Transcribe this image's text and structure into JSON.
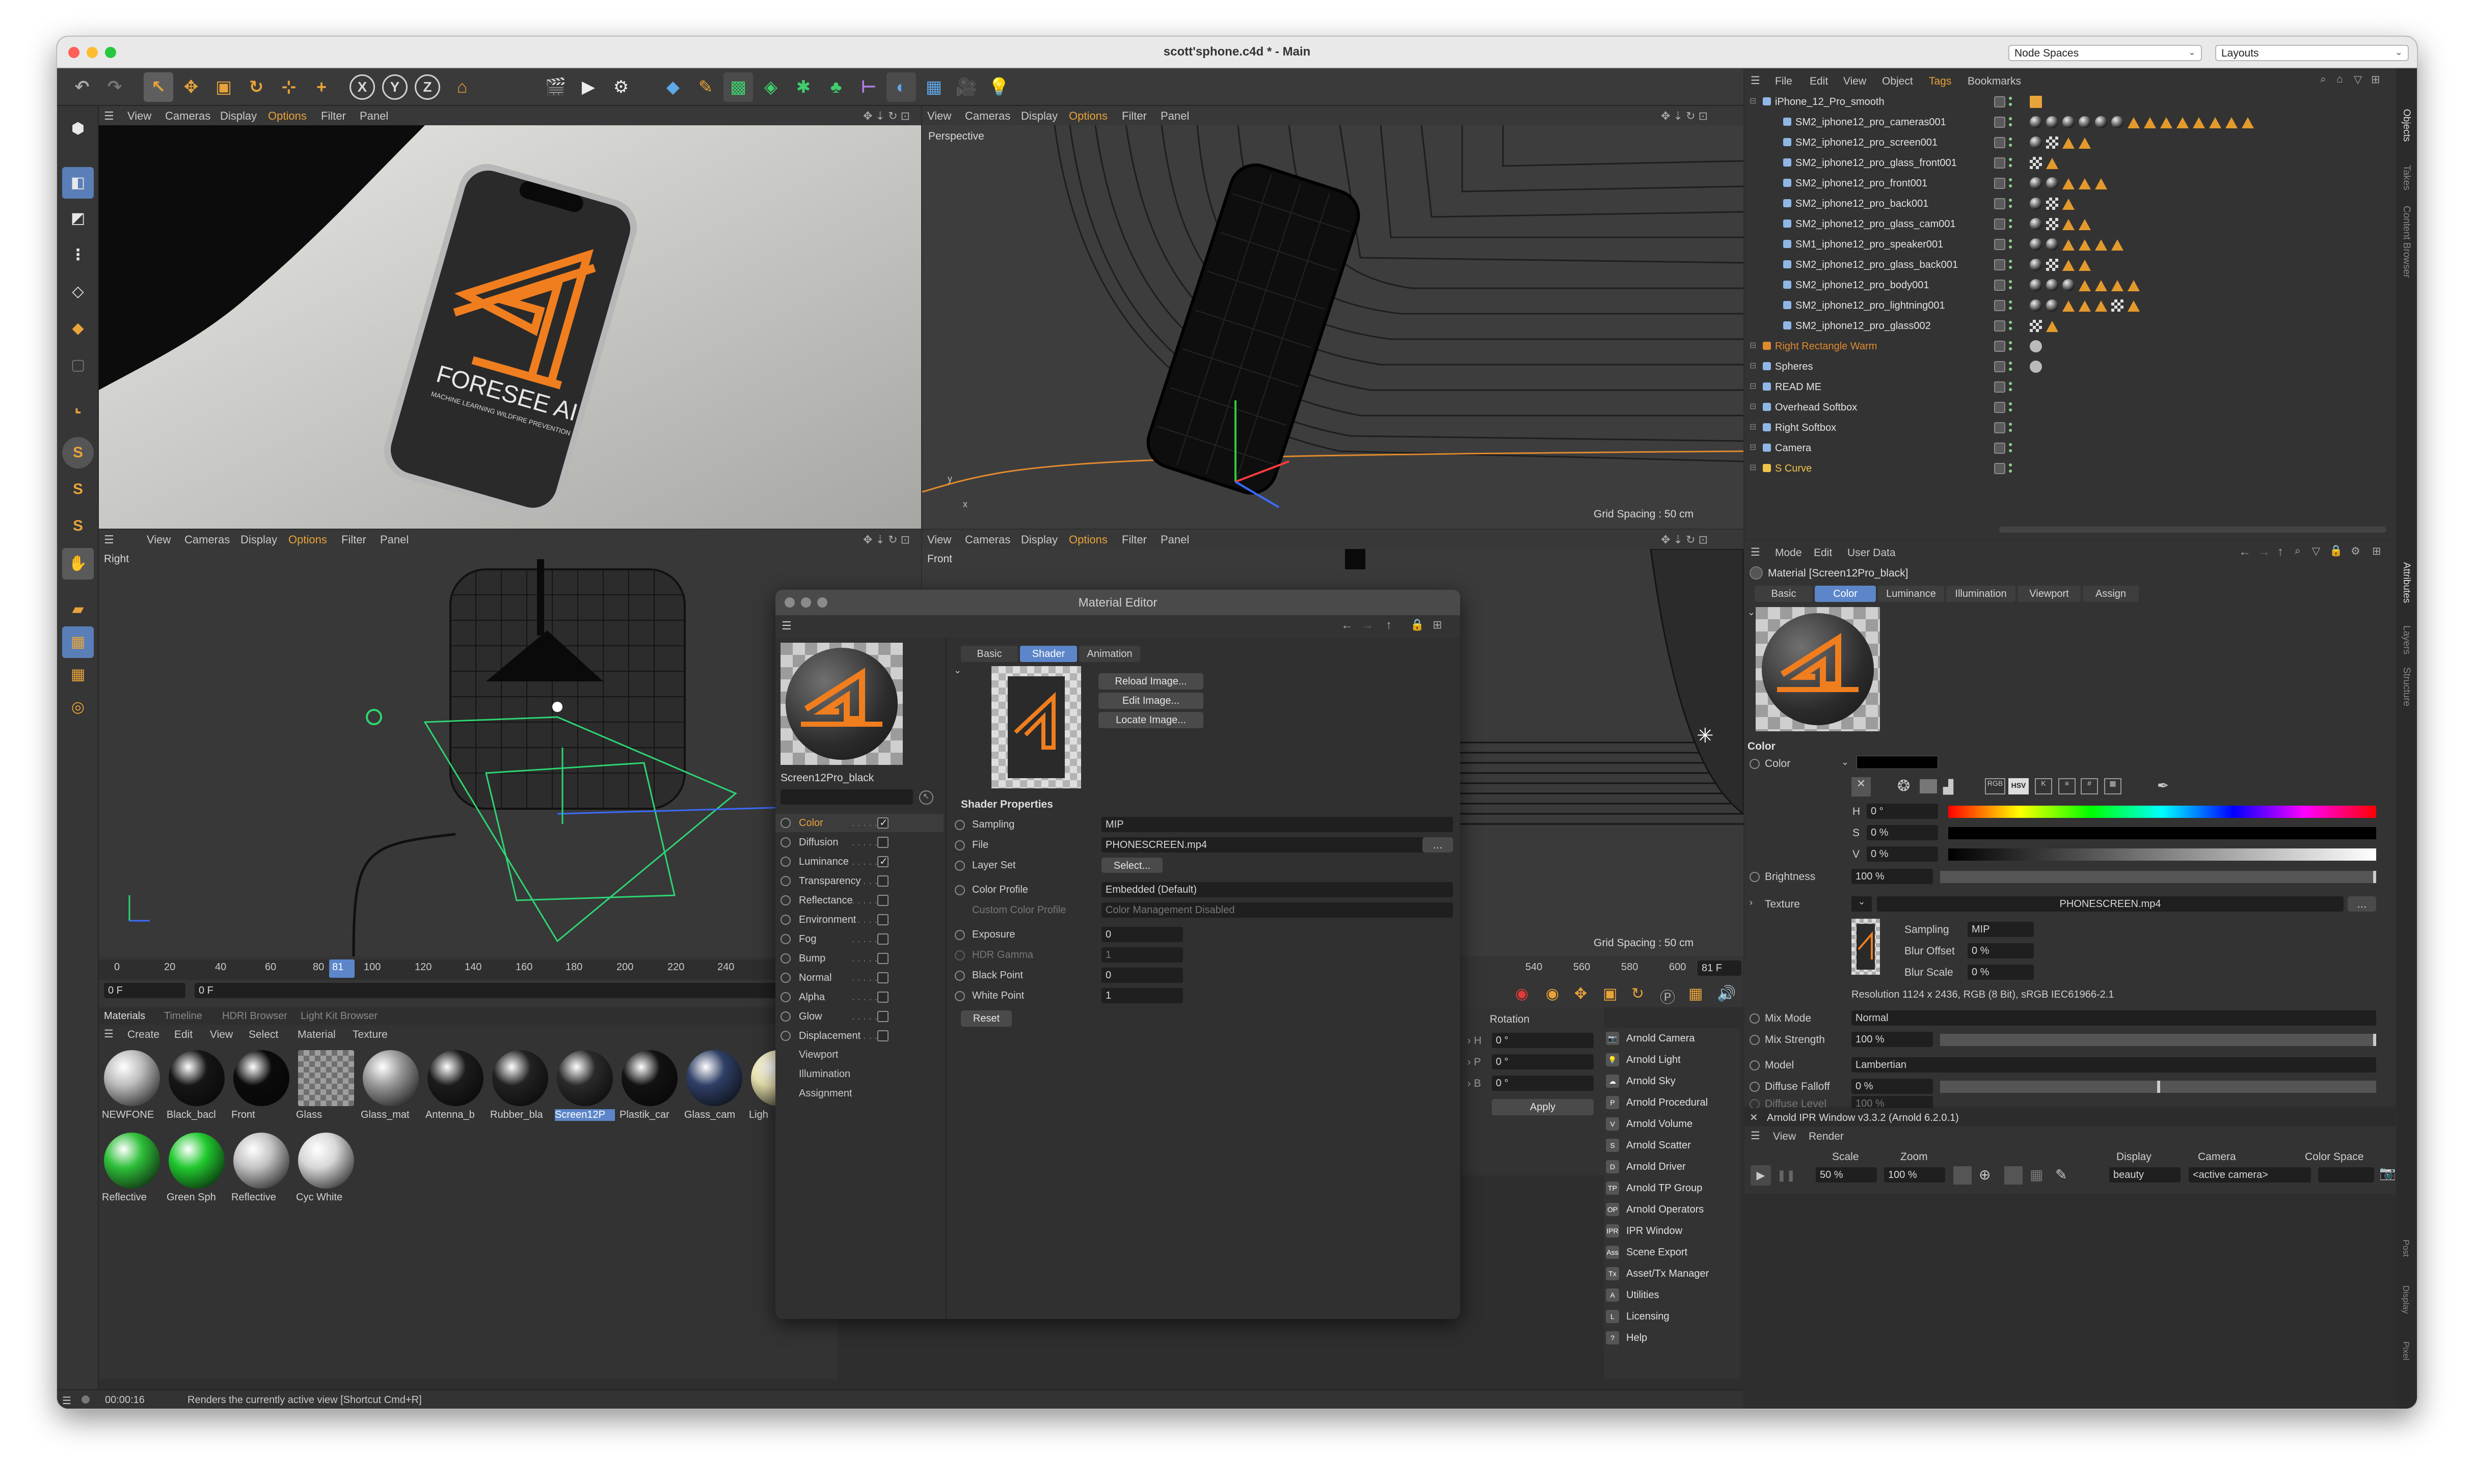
{
  "window": {
    "title": "scott'sphone.c4d * - Main",
    "node_spaces": "Node Spaces",
    "layouts": "Layouts"
  },
  "viewport_menu": [
    "View",
    "Cameras",
    "Display",
    "Options",
    "Filter",
    "Panel"
  ],
  "viewports": {
    "top_right_label": "Perspective",
    "bottom_left_label": "Right",
    "bottom_right_label": "Front",
    "grid_top": "Grid Spacing : 50 cm",
    "grid_bottom": "Grid Spacing : 50 cm"
  },
  "render_text": {
    "logo": "FORESEE AI",
    "tagline": "MACHINE LEARNING WILDFIRE PREVENTION"
  },
  "timeline": {
    "ticks": [
      "0",
      "20",
      "40",
      "60",
      "80",
      "81",
      "100",
      "120",
      "140",
      "160",
      "180",
      "200",
      "220",
      "240"
    ],
    "ticks_right": [
      "540",
      "560",
      "580",
      "600"
    ],
    "frame_field": "81 F",
    "start": "0 F",
    "current": "0 F"
  },
  "material_tabs": [
    "Materials",
    "Timeline",
    "HDRI Browser",
    "Light Kit Browser"
  ],
  "material_menu": [
    "Create",
    "Edit",
    "View",
    "Select",
    "Material",
    "Texture"
  ],
  "materials": [
    {
      "name": "NEWFONE",
      "color": "#bdbdbd"
    },
    {
      "name": "Black_bacl",
      "color": "#161616"
    },
    {
      "name": "Front",
      "color": "#0b0b0b"
    },
    {
      "name": "Glass",
      "color": "checker"
    },
    {
      "name": "Glass_mat",
      "color": "#9a9a9a"
    },
    {
      "name": "Antenna_b",
      "color": "#1c1c1c"
    },
    {
      "name": "Rubber_bla",
      "color": "#222222"
    },
    {
      "name": "Screen12P",
      "color": "#2a2a2a"
    },
    {
      "name": "Plastik_car",
      "color": "#121212"
    },
    {
      "name": "Glass_cam",
      "color": "#2f3f66"
    },
    {
      "name": "Ligh",
      "color": "#e9e3b0"
    },
    {
      "name": "Reflective",
      "color": "#2fbf3a"
    },
    {
      "name": "Green Sph",
      "color": "#21c92f"
    },
    {
      "name": "Reflective",
      "color": "#c4c4c4"
    },
    {
      "name": "Cyc White",
      "color": "#d7d7d7"
    }
  ],
  "status": {
    "time": "00:00:16",
    "message": "Renders the currently active view [Shortcut Cmd+R]"
  },
  "material_editor": {
    "title": "Material Editor",
    "mat_name": "Screen12Pro_black",
    "channels": [
      {
        "label": "Color",
        "checked": true
      },
      {
        "label": "Diffusion",
        "checked": false
      },
      {
        "label": "Luminance",
        "checked": true
      },
      {
        "label": "Transparency",
        "checked": false
      },
      {
        "label": "Reflectance",
        "checked": false
      },
      {
        "label": "Environment",
        "checked": false
      },
      {
        "label": "Fog",
        "checked": false
      },
      {
        "label": "Bump",
        "checked": false
      },
      {
        "label": "Normal",
        "checked": false
      },
      {
        "label": "Alpha",
        "checked": false
      },
      {
        "label": "Glow",
        "checked": false
      },
      {
        "label": "Displacement",
        "checked": false
      }
    ],
    "extra": [
      "Viewport",
      "Illumination",
      "Assignment"
    ],
    "tabs": [
      "Basic",
      "Shader",
      "Animation"
    ],
    "buttons": [
      "Reload Image...",
      "Edit Image...",
      "Locate Image..."
    ],
    "section": "Shader Properties",
    "props": [
      {
        "label": "Sampling",
        "value": "MIP"
      },
      {
        "label": "File",
        "value": "PHONESCREEN.mp4"
      },
      {
        "label": "Layer Set",
        "value": "Select..."
      },
      {
        "label": "Color Profile",
        "value": "Embedded (Default)"
      },
      {
        "label": "Custom Color Profile",
        "value": "Color Management Disabled"
      },
      {
        "label": "Exposure",
        "value": "0"
      },
      {
        "label": "HDR Gamma",
        "value": "1"
      },
      {
        "label": "Black Point",
        "value": "0"
      },
      {
        "label": "White Point",
        "value": "1"
      }
    ],
    "reset": "Reset"
  },
  "coords": {
    "title": "Rotation",
    "h": "0 °",
    "p": "0 °",
    "b": "0 °",
    "apply": "Apply"
  },
  "arnold": [
    "Arnold Camera",
    "Arnold Light",
    "Arnold Sky",
    "Arnold Procedural",
    "Arnold Volume",
    "Arnold Scatter",
    "Arnold Driver",
    "Arnold TP Group",
    "Arnold Operators",
    "IPR Window",
    "Scene Export",
    "Asset/Tx Manager",
    "Utilities",
    "Licensing",
    "Help"
  ],
  "arnold_icons": [
    "📷",
    "💡",
    "☁",
    "P",
    "V",
    "S",
    "D",
    "TP",
    "OP",
    "IPR",
    "Ass",
    "Tx",
    "A",
    "L",
    "?"
  ],
  "objects_menu": [
    "File",
    "Edit",
    "View",
    "Object",
    "Tags",
    "Bookmarks"
  ],
  "objects": [
    {
      "name": "iPhone_12_Pro_smooth",
      "indent": 0,
      "color": "#e2e2e2"
    },
    {
      "name": "SM2_iphone12_pro_cameras001",
      "indent": 1,
      "color": "#e2e2e2"
    },
    {
      "name": "SM2_iphone12_pro_screen001",
      "indent": 1,
      "color": "#e2e2e2"
    },
    {
      "name": "SM2_iphone12_pro_glass_front001",
      "indent": 1,
      "color": "#e2e2e2"
    },
    {
      "name": "SM2_iphone12_pro_front001",
      "indent": 1,
      "color": "#e2e2e2"
    },
    {
      "name": "SM2_iphone12_pro_back001",
      "indent": 1,
      "color": "#e2e2e2"
    },
    {
      "name": "SM2_iphone12_pro_glass_cam001",
      "indent": 1,
      "color": "#e2e2e2"
    },
    {
      "name": "SM1_iphone12_pro_speaker001",
      "indent": 1,
      "color": "#e2e2e2"
    },
    {
      "name": "SM2_iphone12_pro_glass_back001",
      "indent": 1,
      "color": "#e2e2e2"
    },
    {
      "name": "SM2_iphone12_pro_body001",
      "indent": 1,
      "color": "#e2e2e2"
    },
    {
      "name": "SM2_iphone12_pro_lightning001",
      "indent": 1,
      "color": "#e2e2e2"
    },
    {
      "name": "SM2_iphone12_pro_glass002",
      "indent": 1,
      "color": "#e2e2e2"
    },
    {
      "name": "Right Rectangle Warm",
      "indent": 0,
      "color": "#e08a2e"
    },
    {
      "name": "Spheres",
      "indent": 0,
      "color": "#e2e2e2"
    },
    {
      "name": "READ ME",
      "indent": 0,
      "color": "#e2e2e2"
    },
    {
      "name": "Overhead Softbox",
      "indent": 0,
      "color": "#e2e2e2"
    },
    {
      "name": "Right Softbox",
      "indent": 0,
      "color": "#e2e2e2"
    },
    {
      "name": "Camera",
      "indent": 0,
      "color": "#e2e2e2"
    },
    {
      "name": "S Curve",
      "indent": 0,
      "color": "#f0c34a"
    }
  ],
  "side_tabs_top": [
    "Objects",
    "Takes",
    "Content Browser"
  ],
  "side_tabs_bottom": [
    "Attributes",
    "Layers",
    "Structure"
  ],
  "attributes": {
    "menu": [
      "Mode",
      "Edit",
      "User Data"
    ],
    "title": "Material [Screen12Pro_black]",
    "tabs": [
      "Basic",
      "Color",
      "Luminance",
      "Illumination",
      "Viewport",
      "Assign"
    ],
    "section": "Color",
    "color_label": "Color",
    "h": "0 °",
    "s": "0 %",
    "v": "0 %",
    "brightness_label": "Brightness",
    "brightness": "100 %",
    "texture_label": "Texture",
    "texture": "PHONESCREEN.mp4",
    "sampling_label": "Sampling",
    "sampling": "MIP",
    "blur_offset_label": "Blur Offset",
    "blur_offset": "0 %",
    "blur_scale_label": "Blur Scale",
    "blur_scale": "0 %",
    "resolution": "Resolution 1124 x 2436, RGB (8 Bit), sRGB IEC61966-2.1",
    "mix_mode_label": "Mix Mode",
    "mix_mode": "Normal",
    "mix_strength_label": "Mix Strength",
    "mix_strength": "100 %",
    "model_label": "Model",
    "model": "Lambertian",
    "diffuse_falloff_label": "Diffuse Falloff",
    "diffuse_falloff": "0 %",
    "diffuse_level_label": "Diffuse Level",
    "diffuse_level": "100 %",
    "hsv_mode": "HSV"
  },
  "ipr": {
    "title": "Arnold IPR Window v3.3.2 (Arnold 6.2.0.1)",
    "menu": [
      "View",
      "Render"
    ],
    "scale_label": "Scale",
    "scale": "50 %",
    "zoom_label": "Zoom",
    "zoom": "100 %",
    "display_label": "Display",
    "display": "beauty",
    "camera_label": "Camera",
    "camera": "<active camera>",
    "colorspace_label": "Color Space"
  },
  "ipr_side": [
    "Post",
    "Display",
    "Pixel"
  ],
  "colors": {
    "accent": "#e8821f",
    "select": "#5c86c9",
    "bg": "#2e2e2e"
  }
}
